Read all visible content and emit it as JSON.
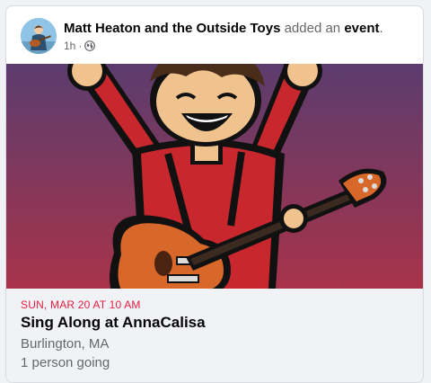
{
  "post": {
    "author": "Matt Heaton and the Outside Toys",
    "verb": " added an ",
    "object": "event",
    "punct": ".",
    "time": "1h",
    "separator": "·",
    "audience_icon": "globe-icon"
  },
  "event": {
    "date": "SUN, MAR 20 AT 10 AM",
    "title": "Sing Along at AnnaCalisa",
    "location": "Burlington, MA",
    "attendance": "1 person going"
  },
  "colors": {
    "date_red": "#e41e3f",
    "secondary_text": "#65676b",
    "cover_top": "#5b3c6e",
    "cover_bottom": "#a8334a",
    "shirt_red": "#c8282d",
    "guitar_orange": "#d8672a"
  }
}
